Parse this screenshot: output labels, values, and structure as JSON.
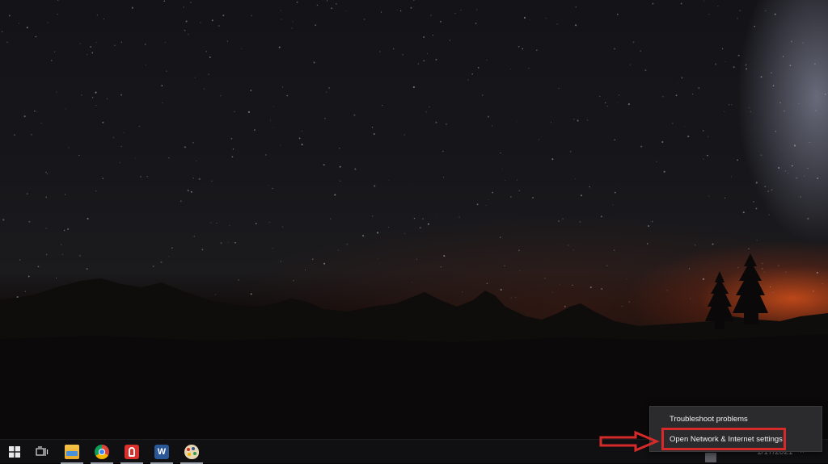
{
  "desktop": {
    "wallpaper": "night-sky-mountains"
  },
  "taskbar": {
    "items": [
      {
        "name": "start-button",
        "icon": "windows-logo-icon",
        "running": false
      },
      {
        "name": "task-view-button",
        "icon": "task-view-icon",
        "running": false
      },
      {
        "name": "file-explorer-button",
        "icon": "folder-icon",
        "running": true
      },
      {
        "name": "chrome-button",
        "icon": "browser-icon",
        "running": true
      },
      {
        "name": "red-app-button",
        "icon": "red-app-icon",
        "running": true
      },
      {
        "name": "word-button",
        "icon": "word-icon",
        "running": true
      },
      {
        "name": "paint-button",
        "icon": "paint-palette-icon",
        "running": true
      }
    ],
    "clock_date": "1/17/2021",
    "chevron": "^"
  },
  "context_menu": {
    "items": [
      {
        "label": "Troubleshoot problems"
      },
      {
        "label": "Open Network & Internet settings"
      }
    ],
    "highlighted_index": 1
  },
  "colors": {
    "annotation_red": "#d62a2a",
    "menu_bg": "#2b2b2d",
    "taskbar_bg": "#101012",
    "sunset_orange": "#c44a1a"
  }
}
